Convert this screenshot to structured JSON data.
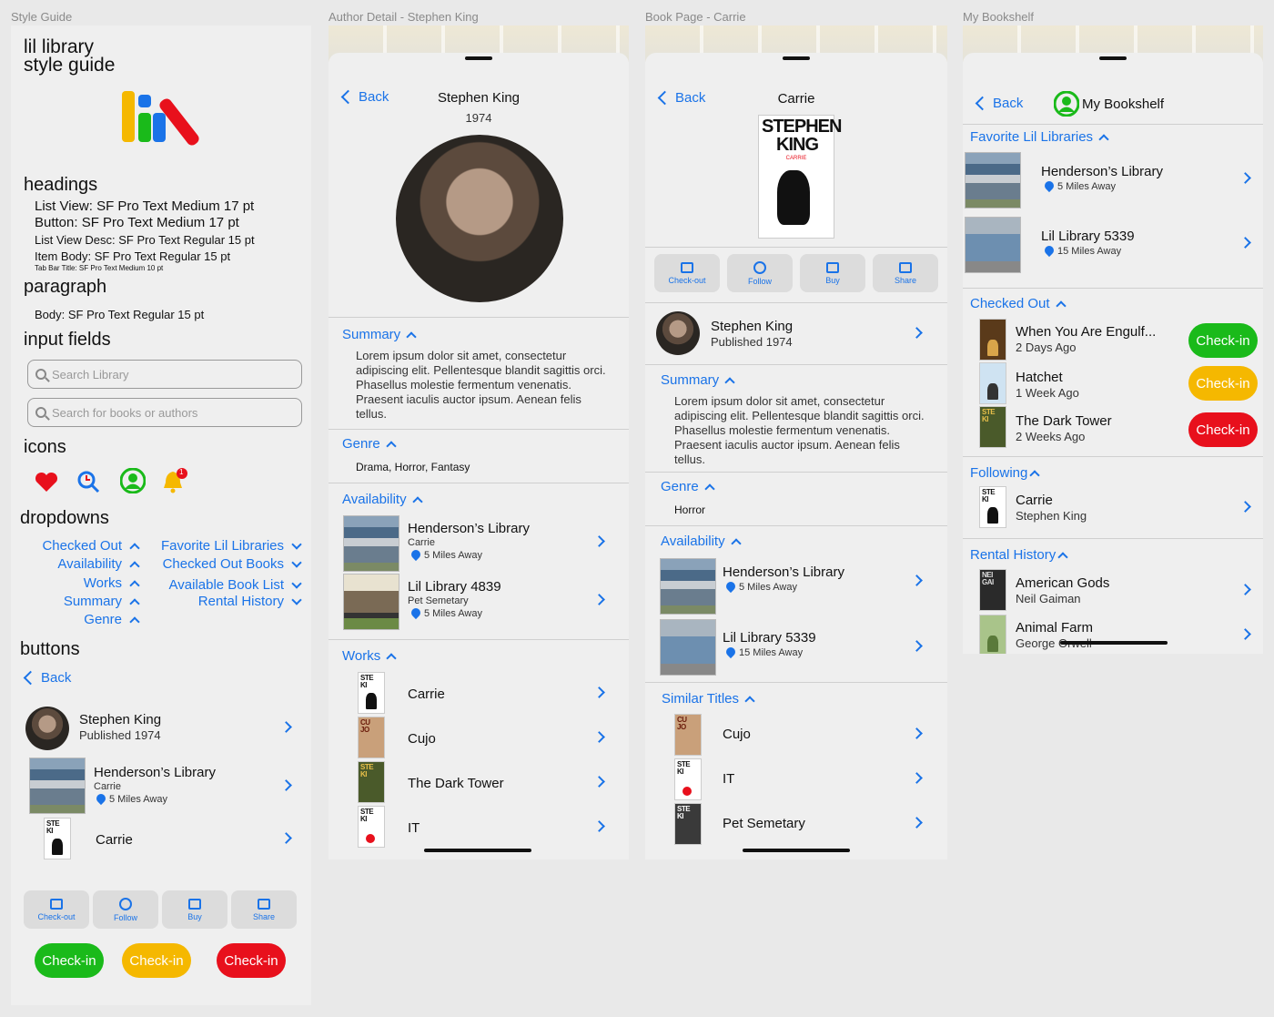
{
  "frames": {
    "style_guide": "Style Guide",
    "author_detail": "Author Detail - Stephen King",
    "book_page": "Book Page - Carrie",
    "my_bookshelf": "My Bookshelf"
  },
  "colors": {
    "accent": "#1a73e8",
    "green": "#1aba1a",
    "yellow": "#f5b800",
    "red": "#e8101c"
  },
  "style": {
    "title_line1": "lil library",
    "title_line2": "style guide",
    "headings_title": "headings",
    "headings": [
      "List View: SF Pro Text Medium 17 pt",
      "Button: SF Pro Text Medium 17 pt",
      "List View Desc: SF Pro Text Regular 15 pt",
      "Item Body: SF Pro Text Regular 15 pt",
      "Tab Bar Title: SF Pro Text Medium 10 pt"
    ],
    "paragraph_title": "paragraph",
    "paragraph_body": "Body: SF Pro Text Regular 15 pt",
    "inputs_title": "input fields",
    "search_library_placeholder": "Search Library",
    "search_books_placeholder": "Search for books or authors",
    "icons_title": "icons",
    "icons": [
      "heart-icon",
      "clock-search-icon",
      "user-icon",
      "bell-icon"
    ],
    "bell_badge": "1",
    "dropdowns_title": "dropdowns",
    "dropdowns_left": [
      "Checked Out",
      "Availability",
      "Works",
      "Summary",
      "Genre"
    ],
    "dropdowns_right": [
      "Favorite Lil Libraries",
      "Checked Out Books",
      "Available Book List",
      "Rental History"
    ],
    "buttons_title": "buttons",
    "back": "Back",
    "author_name": "Stephen King",
    "author_published": "Published 1974",
    "library_name": "Henderson’s Library",
    "library_book": "Carrie",
    "library_distance": "5 Miles Away",
    "book_title": "Carrie",
    "actions": [
      "Check-out",
      "Follow",
      "Buy",
      "Share"
    ],
    "checkin": "Check-in"
  },
  "author": {
    "back": "Back",
    "name": "Stephen King",
    "year": "1974",
    "summary_label": "Summary",
    "summary": "Lorem ipsum dolor sit amet, consectetur adipiscing elit. Pellentesque blandit sagittis orci. Phasellus molestie fermentum venenatis. Praesent iaculis auctor ipsum. Aenean felis tellus.",
    "genre_label": "Genre",
    "genre": "Drama, Horror, Fantasy",
    "availability_label": "Availability",
    "availability": [
      {
        "name": "Henderson’s Library",
        "book": "Carrie",
        "distance": "5 Miles Away"
      },
      {
        "name": "Lil Library 4839",
        "book": "Pet Semetary",
        "distance": "5 Miles Away"
      }
    ],
    "works_label": "Works",
    "works": [
      "Carrie",
      "Cujo",
      "The Dark Tower",
      "IT"
    ]
  },
  "book": {
    "back": "Back",
    "title": "Carrie",
    "cover_author": "STEPHEN KING",
    "cover_title": "CARRIE",
    "actions": [
      "Check-out",
      "Follow",
      "Buy",
      "Share"
    ],
    "author_name": "Stephen King",
    "author_published": "Published 1974",
    "summary_label": "Summary",
    "summary": "Lorem ipsum dolor sit amet, consectetur adipiscing elit. Pellentesque blandit sagittis orci. Phasellus molestie fermentum venenatis. Praesent iaculis auctor ipsum. Aenean felis tellus.",
    "genre_label": "Genre",
    "genre": "Horror",
    "availability_label": "Availability",
    "availability": [
      {
        "name": "Henderson’s Library",
        "distance": "5 Miles Away"
      },
      {
        "name": "Lil Library 5339",
        "distance": "15 Miles Away"
      }
    ],
    "similar_label": "Similar Titles",
    "similar": [
      "Cujo",
      "IT",
      "Pet Semetary"
    ]
  },
  "shelf": {
    "back": "Back",
    "title": "My Bookshelf",
    "fav_label": "Favorite Lil Libraries",
    "favorites": [
      {
        "name": "Henderson’s Library",
        "distance": "5 Miles Away"
      },
      {
        "name": "Lil Library 5339",
        "distance": "15 Miles Away"
      }
    ],
    "checked_label": "Checked Out",
    "checked": [
      {
        "title": "When You Are Engulf...",
        "time": "2 Days Ago",
        "button": "Check-in"
      },
      {
        "title": "Hatchet",
        "time": "1 Week Ago",
        "button": "Check-in"
      },
      {
        "title": "The Dark Tower",
        "time": "2 Weeks Ago",
        "button": "Check-in"
      }
    ],
    "following_label": "Following",
    "following": [
      {
        "title": "Carrie",
        "author": "Stephen King"
      }
    ],
    "rental_label": "Rental History",
    "rental": [
      {
        "title": "American Gods",
        "author": "Neil Gaiman"
      },
      {
        "title": "Animal Farm",
        "author": "George Orwell"
      }
    ]
  }
}
